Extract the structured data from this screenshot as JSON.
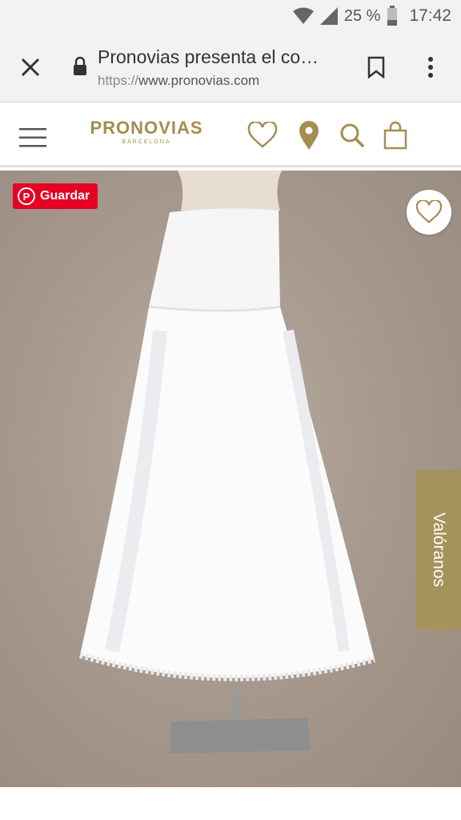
{
  "status_bar": {
    "battery": "25 %",
    "time": "17:42",
    "icons": [
      "wifi-icon",
      "signal-icon",
      "battery-icon"
    ]
  },
  "browser": {
    "page_title": "Pronovias presenta el co…",
    "url_scheme": "https://",
    "url_host": "www.pronovias.com",
    "icons": [
      "close-icon",
      "lock-icon",
      "bookmark-icon",
      "more-vert-icon"
    ]
  },
  "site": {
    "brand": "PRONOVIAS",
    "brand_sub": "BARCELONA",
    "brand_color": "#a38d4f",
    "icons": [
      "menu-icon",
      "heart-icon",
      "location-pin-icon",
      "search-icon",
      "shopping-bag-icon"
    ]
  },
  "product": {
    "pin_label": "Guardar",
    "pin_color": "#e60023",
    "rate_label": "Valóranos",
    "rate_color": "#a6935b"
  }
}
